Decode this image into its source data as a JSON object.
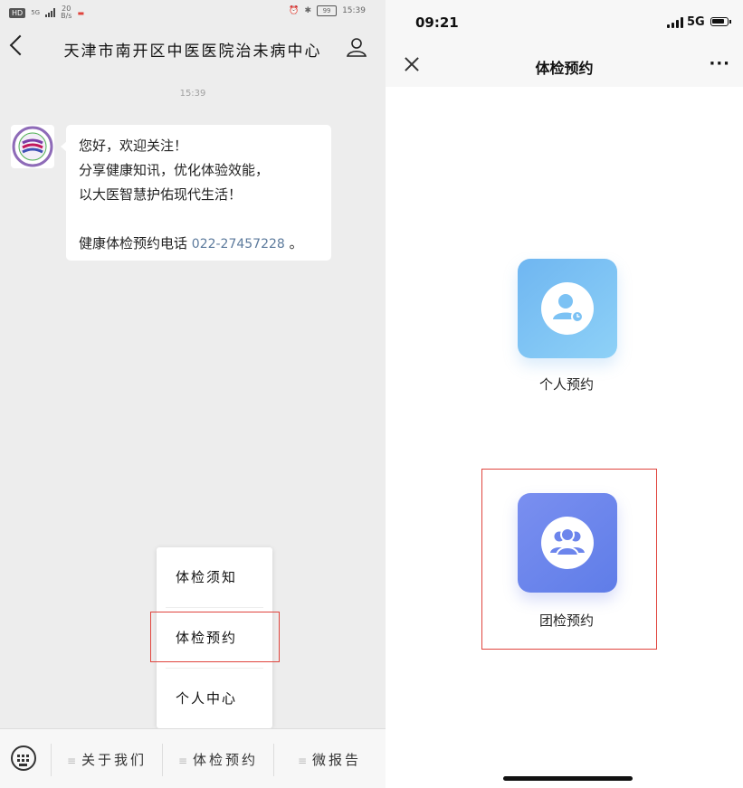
{
  "left": {
    "status": {
      "hd": "HD",
      "net": "5G",
      "speed_value": "20",
      "speed_unit": "B/s",
      "time": "15:39",
      "battery": "99"
    },
    "nav": {
      "title": "天津市南开区中医医院治未病中心"
    },
    "chat": {
      "timestamp": "15:39",
      "message": {
        "line1": "您好，欢迎关注！",
        "line2": "分享健康知讯，优化体验效能，",
        "line3": "以大医智慧护佑现代生活！",
        "line4_prefix": "健康体检预约电话 ",
        "phone": "022-27457228",
        "line4_suffix": " 。"
      }
    },
    "popup_menu": {
      "items": [
        "体检须知",
        "体检预约",
        "个人中心"
      ]
    },
    "bottom_menu": {
      "menu_icon": "≡",
      "tabs": [
        "关于我们",
        "体检预约",
        "微报告"
      ]
    }
  },
  "right": {
    "status": {
      "time": "09:21",
      "net": "5G"
    },
    "nav": {
      "title": "体检预约",
      "more": "···"
    },
    "tiles": [
      {
        "label": "个人预约",
        "icon": "user-clock-icon"
      },
      {
        "label": "团检预约",
        "icon": "group-icon"
      }
    ]
  },
  "colors": {
    "highlight_box": "#e0443d",
    "tile_personal": "#7cc2f4",
    "tile_group": "#6c85ec",
    "link": "#5c7a9c"
  }
}
